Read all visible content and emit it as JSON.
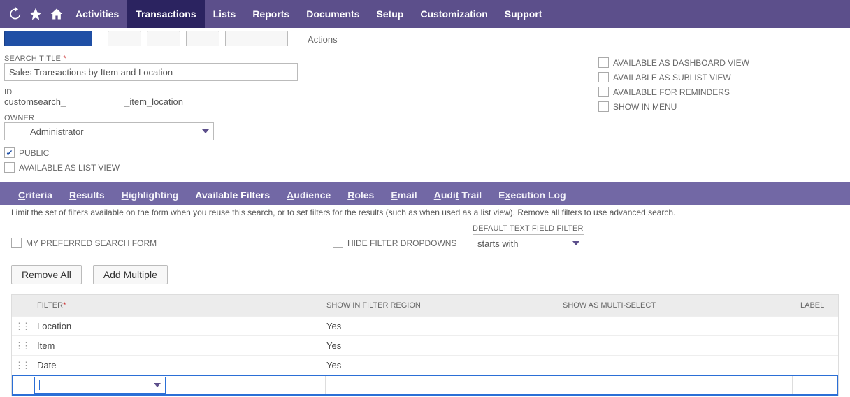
{
  "nav": {
    "items": [
      "Activities",
      "Transactions",
      "Lists",
      "Reports",
      "Documents",
      "Setup",
      "Customization",
      "Support"
    ],
    "active_index": 1
  },
  "toolbar": {
    "actions_label": "Actions"
  },
  "form": {
    "search_title_label": "SEARCH TITLE",
    "search_title_value": "Sales Transactions by Item and Location",
    "id_label": "ID",
    "id_prefix": "customsearch_",
    "id_suffix": "_item_location",
    "owner_label": "OWNER",
    "owner_value": "Administrator",
    "checkboxes_left": [
      {
        "label": "PUBLIC",
        "checked": true
      },
      {
        "label": "AVAILABLE AS LIST VIEW",
        "checked": false
      }
    ],
    "checkboxes_right": [
      {
        "label": "AVAILABLE AS DASHBOARD VIEW",
        "checked": false
      },
      {
        "label": "AVAILABLE AS SUBLIST VIEW",
        "checked": false
      },
      {
        "label": "AVAILABLE FOR REMINDERS",
        "checked": false
      },
      {
        "label": "SHOW IN MENU",
        "checked": false
      }
    ]
  },
  "tabs": {
    "items": [
      {
        "label": "Criteria",
        "u": "C"
      },
      {
        "label": "Results",
        "u": "R"
      },
      {
        "label": "Highlighting",
        "u": "H"
      },
      {
        "label": "Available Filters",
        "u": null,
        "active": true
      },
      {
        "label": "Audience",
        "u": "A"
      },
      {
        "label": "Roles",
        "u": "R"
      },
      {
        "label": "Email",
        "u": "E"
      },
      {
        "label": "Audit Trail",
        "u": null
      },
      {
        "label": "Execution Log",
        "u": null
      }
    ],
    "desc": "Limit the set of filters available on the form when you reuse this search, or to set filters for the results (such as when used as a list view). Remove all filters to use advanced search.",
    "my_pref_label": "MY PREFERRED SEARCH FORM",
    "hide_filter_dd_label": "HIDE FILTER DROPDOWNS",
    "default_text_filter_label": "DEFAULT TEXT FIELD FILTER",
    "default_text_filter_value": "starts with"
  },
  "buttons": {
    "remove_all": "Remove All",
    "add_multiple": "Add Multiple"
  },
  "grid": {
    "headers": {
      "filter": "FILTER",
      "region": "SHOW IN FILTER REGION",
      "multi": "SHOW AS MULTI-SELECT",
      "label": "LABEL"
    },
    "rows": [
      {
        "filter": "Location",
        "region": "Yes",
        "multi": "",
        "label": ""
      },
      {
        "filter": "Item",
        "region": "Yes",
        "multi": "",
        "label": ""
      },
      {
        "filter": "Date",
        "region": "Yes",
        "multi": "",
        "label": ""
      }
    ]
  }
}
